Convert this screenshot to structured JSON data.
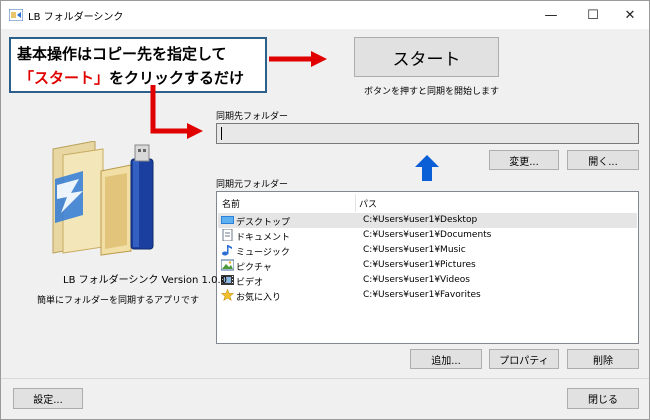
{
  "window": {
    "title": "LB フォルダーシンク",
    "minimize": "—",
    "maximize": "☐",
    "close": "✕"
  },
  "callout": {
    "line1": "基本操作はコピー先を指定して",
    "line2_highlight": "「スタート」",
    "line2_rest": "をクリックするだけ"
  },
  "start": {
    "button_label": "スタート",
    "hint": "ボタンを押すと同期を開始します"
  },
  "destination": {
    "label": "同期先フォルダー",
    "value": "",
    "change_button": "変更...",
    "open_button": "開く..."
  },
  "source": {
    "label": "同期元フォルダー",
    "columns": [
      "名前",
      "パス"
    ],
    "rows": [
      {
        "name": "デスクトップ",
        "path": "C:¥Users¥user1¥Desktop",
        "icon": "desktop-icon"
      },
      {
        "name": "ドキュメント",
        "path": "C:¥Users¥user1¥Documents",
        "icon": "document-icon"
      },
      {
        "name": "ミュージック",
        "path": "C:¥Users¥user1¥Music",
        "icon": "music-icon"
      },
      {
        "name": "ピクチャ",
        "path": "C:¥Users¥user1¥Pictures",
        "icon": "picture-icon"
      },
      {
        "name": "ビデオ",
        "path": "C:¥Users¥user1¥Videos",
        "icon": "video-icon"
      },
      {
        "name": "お気に入り",
        "path": "C:¥Users¥user1¥Favorites",
        "icon": "star-icon"
      }
    ],
    "add_button": "追加...",
    "properties_button": "プロパティ",
    "delete_button": "削除"
  },
  "app": {
    "name": "LB フォルダーシンク Version 1.0.0",
    "description": "簡単にフォルダーを同期するアプリです"
  },
  "footer": {
    "settings_button": "設定...",
    "close_button": "閉じる"
  },
  "colors": {
    "annotation_red": "#e00000",
    "annotation_blue": "#0a5fd6",
    "callout_border": "#2c5f8a"
  }
}
